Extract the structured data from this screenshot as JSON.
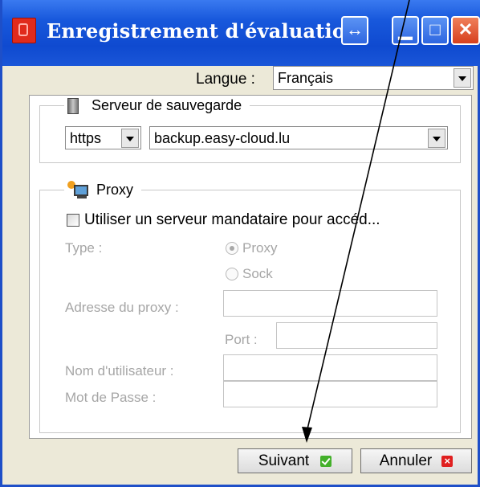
{
  "window": {
    "title": "Enregistrement d'évaluation",
    "buttons": {
      "resize": "↔",
      "minimize": "▁",
      "maximize": "□",
      "close": "✕"
    }
  },
  "language": {
    "label": "Langue :",
    "selected": "Français"
  },
  "backup_server": {
    "legend": "Serveur de sauvegarde",
    "protocol": "https",
    "host": "backup.easy-cloud.lu"
  },
  "proxy": {
    "legend": "Proxy",
    "use_proxy_label": "Utiliser un serveur mandataire pour accéd...",
    "use_proxy_checked": false,
    "type_label": "Type :",
    "type_options": [
      "Proxy",
      "Sock"
    ],
    "type_selected": "Proxy",
    "address_label": "Adresse du proxy :",
    "port_label": "Port :",
    "username_label": "Nom d'utilisateur :",
    "password_label": "Mot de Passe :",
    "address_value": "",
    "port_value": "",
    "username_value": "",
    "password_value": ""
  },
  "footer": {
    "next_label": "Suivant",
    "cancel_label": "Annuler"
  },
  "icons": {
    "app": "app-logo-icon",
    "server": "server-icon",
    "proxy": "proxy-computer-icon",
    "next": "check-icon",
    "cancel": "close-icon"
  },
  "colors": {
    "titlebar": "#1858dc",
    "close_button": "#d6401e",
    "window_bg": "#ece9d8",
    "disabled_text": "#a6a6a6",
    "ok_icon": "#43b02a",
    "cancel_icon": "#e02020"
  }
}
